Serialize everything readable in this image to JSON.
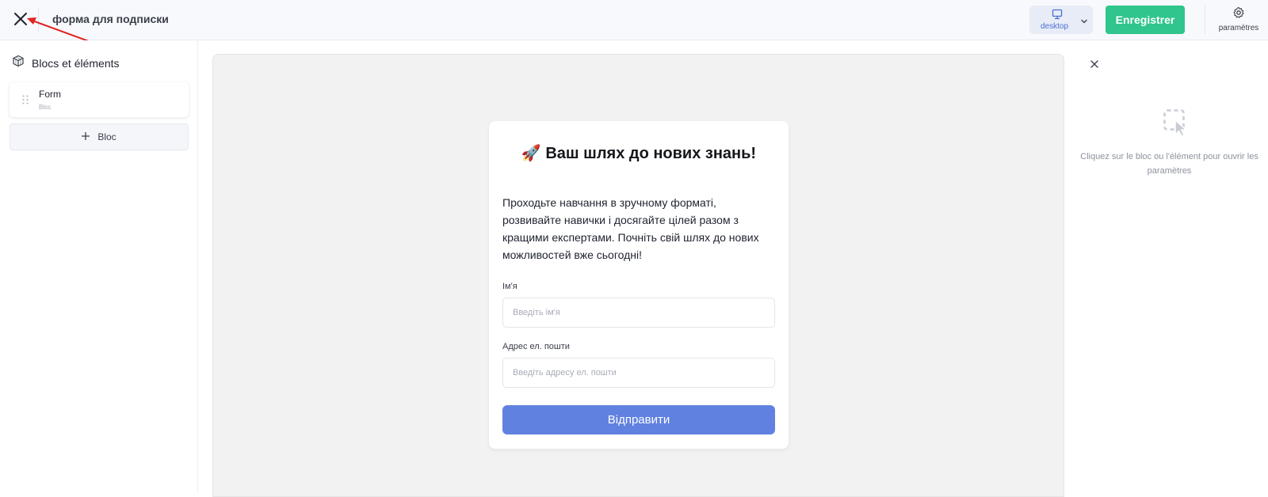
{
  "header": {
    "title": "форма для подписки",
    "device_label": "desktop",
    "save_label": "Enregistrer",
    "settings_label": "paramètres"
  },
  "sidebar": {
    "title": "Blocs et éléments",
    "blocks": [
      {
        "name": "Form",
        "type": "Bloc"
      }
    ],
    "add_bloc_label": "Bloc"
  },
  "form": {
    "title": "🚀 Ваш шлях до нових знань!",
    "description": "Проходьте навчання в зручному форматі, розвивайте навички і досягайте цілей разом з кращими експертами. Почніть свій шлях до нових можливостей вже сьогодні!",
    "fields": [
      {
        "label": "Ім'я",
        "placeholder": "Введіть ім'я"
      },
      {
        "label": "Адрес ел. пошти",
        "placeholder": "Введіть адресу ел. пошти"
      }
    ],
    "submit_label": "Відправити"
  },
  "right_panel": {
    "hint": "Cliquez sur le bloc ou l'élément pour ouvrir les paramètres"
  },
  "colors": {
    "save": "#2fc58c",
    "submit": "#6081e0",
    "device_accent": "#4a6fd8",
    "annotation_arrow": "#e02424"
  },
  "icons": [
    "close-icon",
    "monitor-icon",
    "chevron-down-icon",
    "gear-icon",
    "cube-icon",
    "drag-handle-icon",
    "plus-icon",
    "select-element-icon"
  ]
}
